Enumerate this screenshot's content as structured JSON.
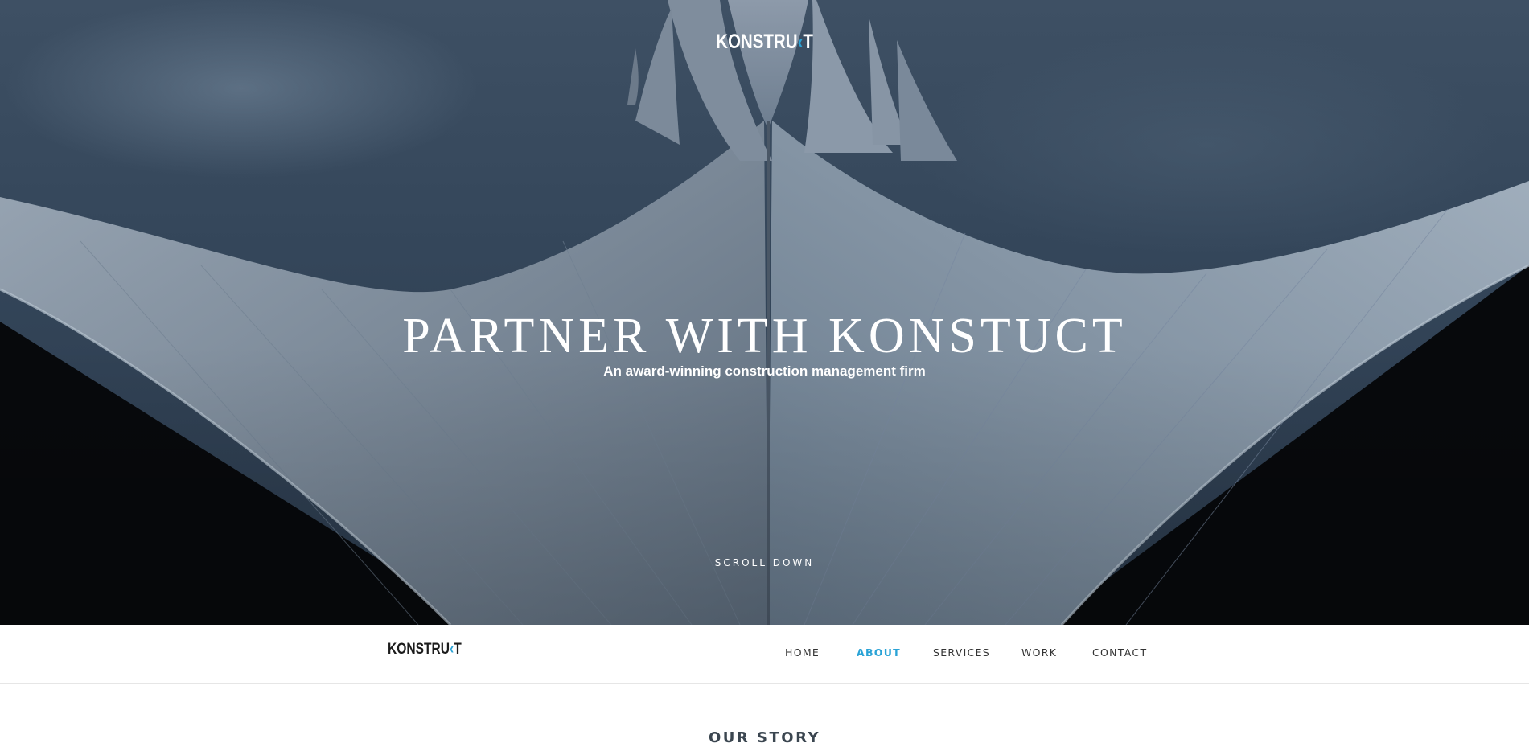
{
  "hero": {
    "logo": {
      "text_main": "KONSTRU",
      "text_accent": "‹",
      "text_end": "T"
    },
    "title": "PARTNER WITH KONSTUCT",
    "subtitle": "An award-winning construction management firm",
    "scroll_label": "SCROLL DOWN"
  },
  "navbar": {
    "logo": {
      "text_main": "KONSTRU",
      "text_accent": "‹",
      "text_end": "T"
    },
    "items": [
      {
        "label": "HOME",
        "active": false
      },
      {
        "label": "ABOUT",
        "active": true
      },
      {
        "label": "SERVICES",
        "active": false
      },
      {
        "label": "WORK",
        "active": false
      },
      {
        "label": "CONTACT",
        "active": false
      }
    ]
  },
  "story": {
    "heading": "OUR STORY"
  },
  "colors": {
    "accent": "#2aa3d6",
    "nav_text": "#333333",
    "heading_text": "#3b4650",
    "sky": "#34465a"
  }
}
